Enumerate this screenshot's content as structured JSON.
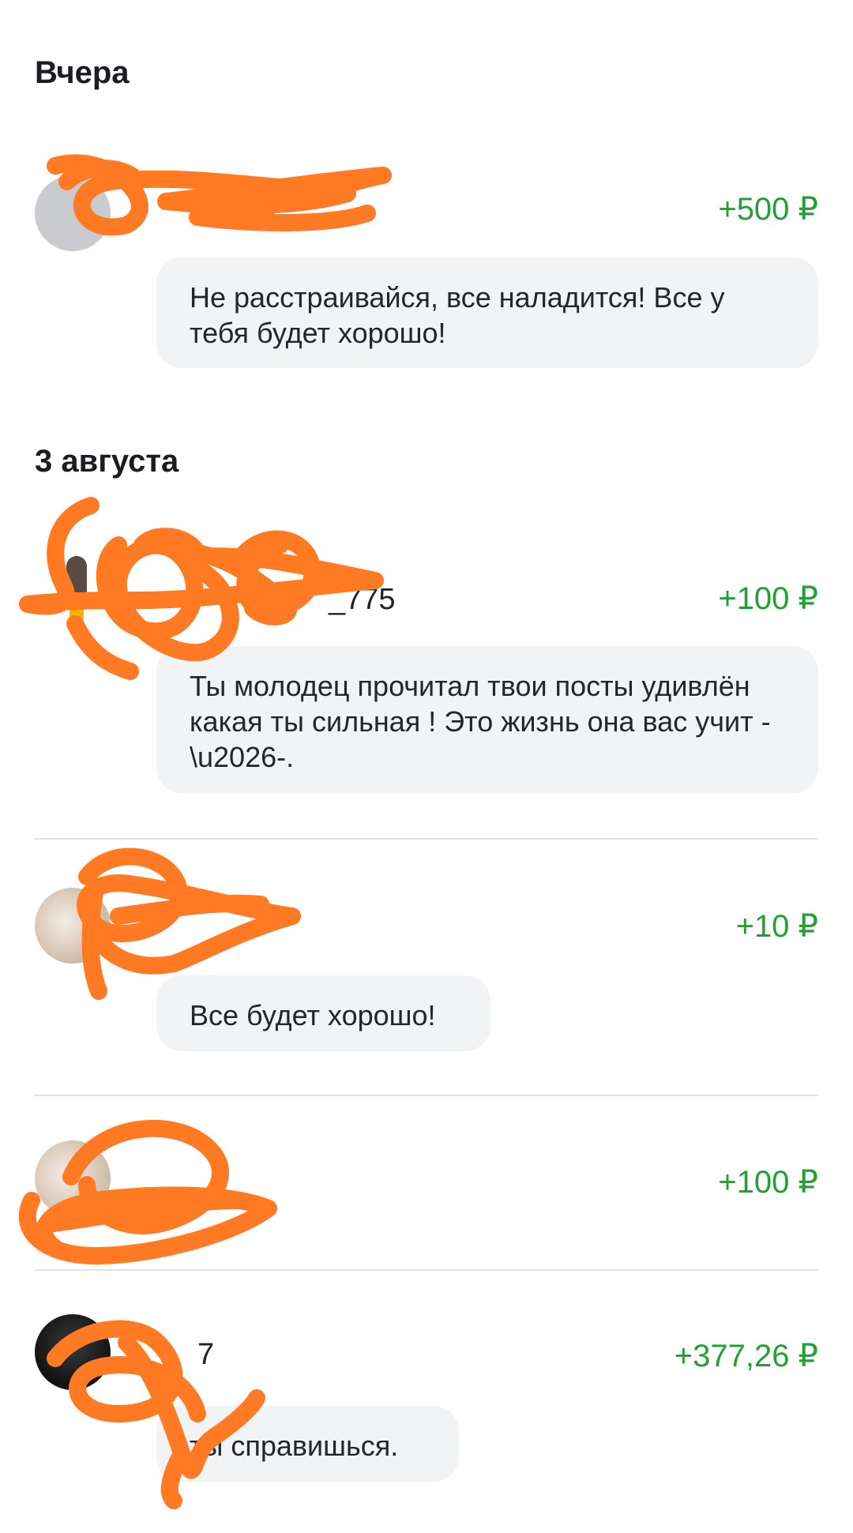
{
  "sections": [
    {
      "title": "Вчера",
      "items": [
        {
          "name": "",
          "amount": "+500 ₽",
          "message": "Не расстраивайся, все наладится! Все у тебя будет хорошо!"
        }
      ]
    },
    {
      "title": "3 августа",
      "items": [
        {
          "name": "_775",
          "amount": "+100 ₽",
          "message": "Ты молодец прочитал твои посты удивлён какая ты сильная ! Это жизнь она вас учит -\\u2026-."
        },
        {
          "name": "",
          "amount": "+10 ₽",
          "message": "Все будет хорошо!"
        },
        {
          "name": "",
          "amount": "+100 ₽",
          "message": ""
        },
        {
          "name": "7",
          "amount": "+377,26 ₽",
          "message": "ты справишься."
        }
      ]
    }
  ],
  "colors": {
    "amount": "#21a038",
    "bubble": "#f2f3f5",
    "scribble": "#ff7a22"
  }
}
